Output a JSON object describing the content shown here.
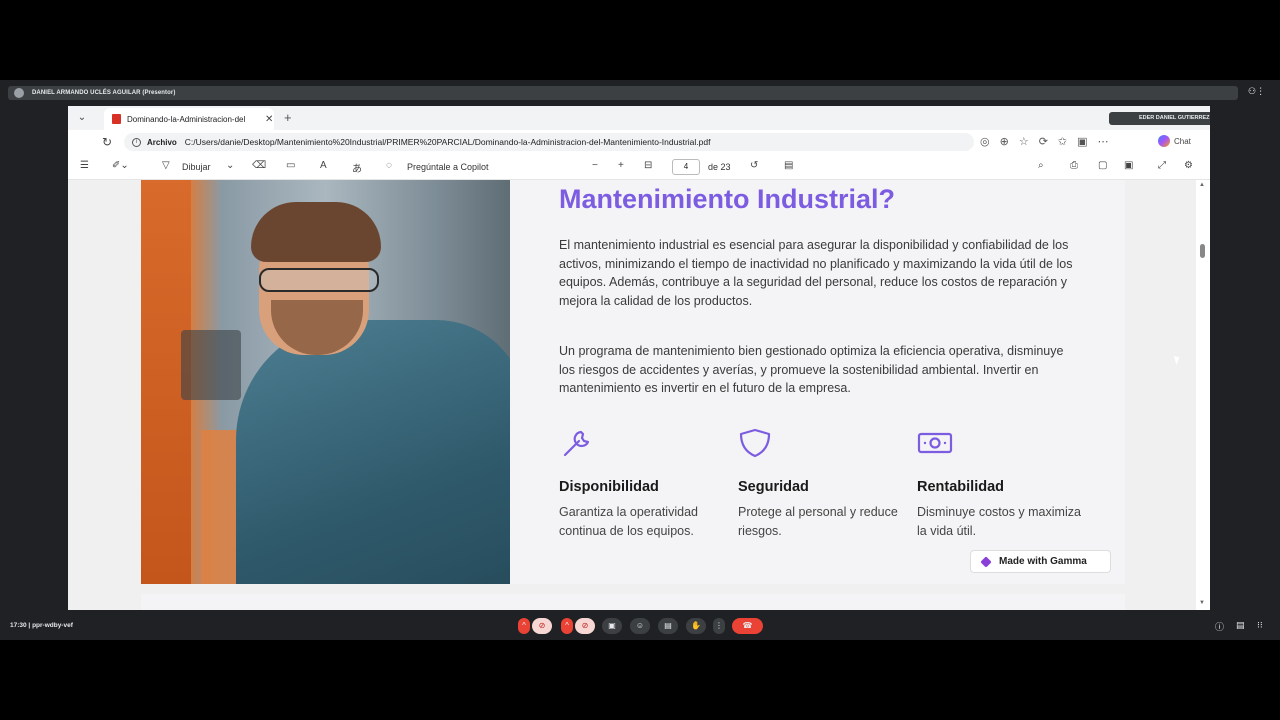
{
  "meet": {
    "presenter_label": "DANIEL ARMANDO UCLÉS AGUILAR (Presentor)",
    "other_participant": "EDER DANIEL GUTIERREZ JIMENEZ",
    "time": "17:30",
    "meeting_code": "ppr-wdby-vef"
  },
  "browser": {
    "tab_title": "Dominando-la-Administracion-del",
    "address_scheme": "Archivo",
    "url": "C:/Users/danie/Desktop/Mantenimiento%20Industrial/PRIMER%20PARCIAL/Dominando-la-Administracion-del-Mantenimiento-Industrial.pdf",
    "chat_label": "Chat"
  },
  "pdf_toolbar": {
    "draw_label": "Dibujar",
    "copilot_label": "Pregúntale a Copilot",
    "page_current": "4",
    "page_total": "de 23"
  },
  "slide": {
    "heading": "Mantenimiento Industrial?",
    "paragraph_1": "El mantenimiento industrial es esencial para asegurar la disponibilidad y confiabilidad de los activos, minimizando el tiempo de inactividad no planificado y maximizando la vida útil de los equipos. Además, contribuye a la seguridad del personal, reduce los costos de reparación y mejora la calidad de los productos.",
    "paragraph_2": "Un programa de mantenimiento bien gestionado optimiza la eficiencia operativa, disminuye los riesgos de accidentes y averías, y promueve la sostenibilidad ambiental. Invertir en mantenimiento es invertir en el futuro de la empresa.",
    "features": [
      {
        "title": "Disponibilidad",
        "description": "Garantiza la operatividad continua de los equipos.",
        "icon": "wrench-icon"
      },
      {
        "title": "Seguridad",
        "description": "Protege al personal y reduce riesgos.",
        "icon": "shield-icon"
      },
      {
        "title": "Rentabilidad",
        "description": "Disminuye costos y maximiza la vida útil.",
        "icon": "money-icon"
      }
    ],
    "badge": "Made with Gamma",
    "accent_color": "#7c5ce0"
  }
}
